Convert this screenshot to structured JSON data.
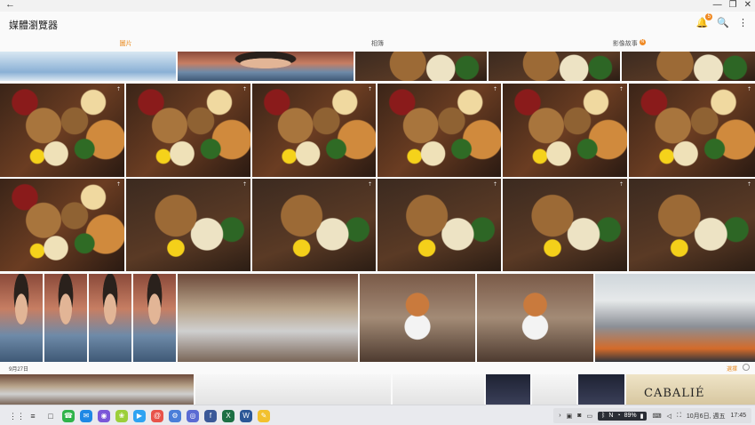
{
  "window": {
    "back_icon": "arrow-back-icon",
    "controls": [
      "minimize",
      "restore",
      "close"
    ],
    "control_glyphs": [
      "—",
      "❐",
      "✕"
    ]
  },
  "appbar": {
    "title": "媒體瀏覽器",
    "notification_count": "5",
    "icons": [
      "bell-icon",
      "search-icon",
      "more-vert-icon"
    ]
  },
  "tabs": [
    {
      "label": "圖片",
      "active": true
    },
    {
      "label": "相簿",
      "active": false
    },
    {
      "label": "影像故事",
      "active": false,
      "badge": "N"
    }
  ],
  "section": {
    "date": "9月27日",
    "select_label": "選擇"
  },
  "taskbar": {
    "battery": "89%",
    "datetime": "10月6日, 週五",
    "time": "17:45"
  },
  "colors": {
    "accent": "#e98a1f",
    "taskbar_bg": "#e9eaee"
  }
}
